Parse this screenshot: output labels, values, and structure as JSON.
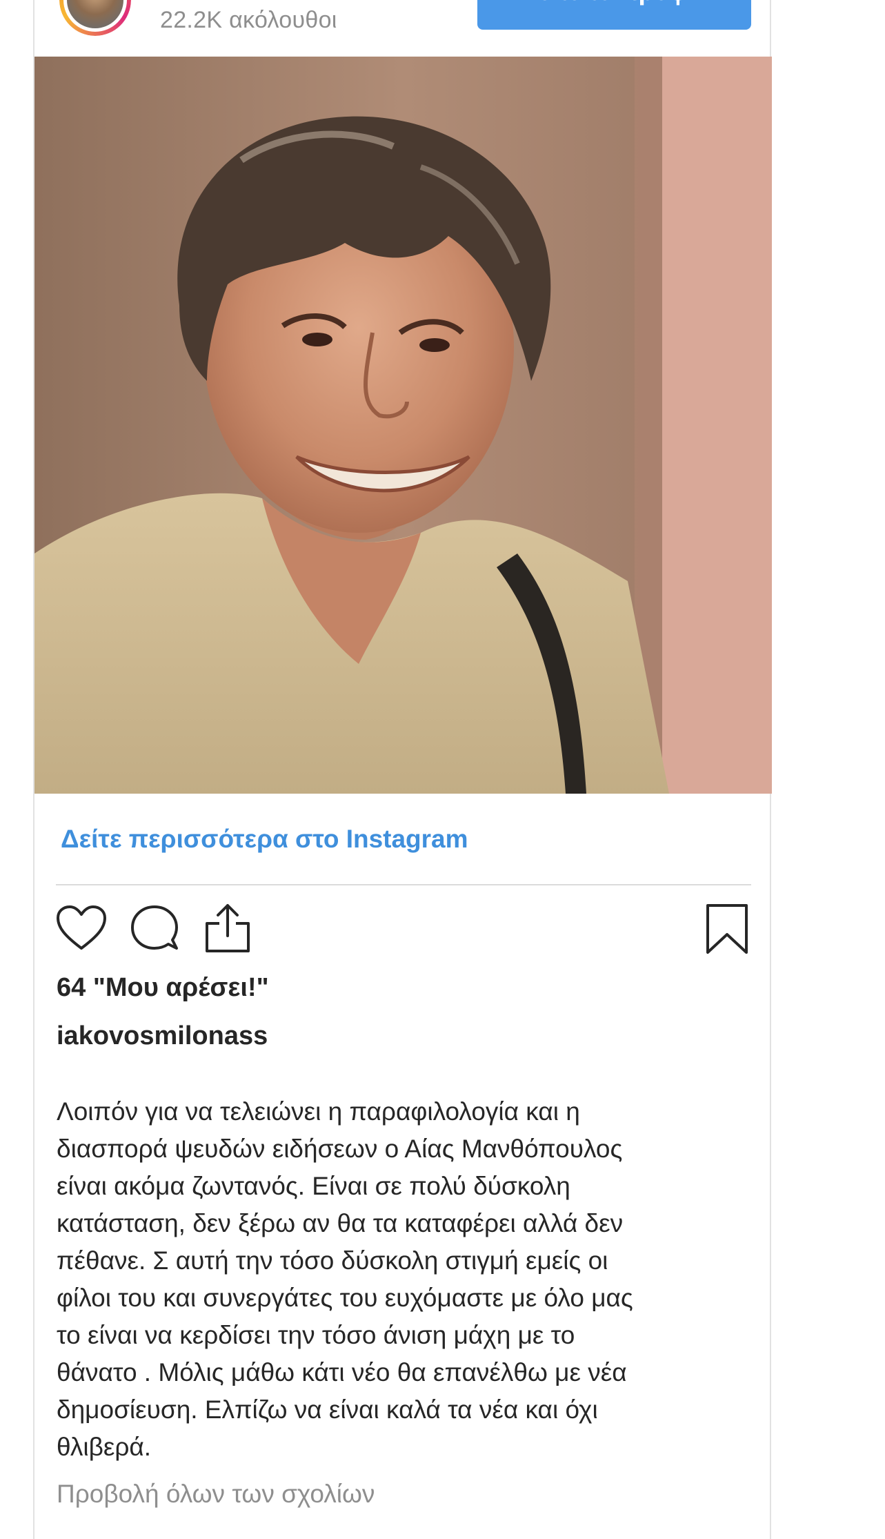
{
  "header": {
    "followers": "22.2K ακόλουθοι",
    "view_profile_label": "Δείτε το προφίλ"
  },
  "post": {
    "image_alt": "Smiling man with grey-streaked hair in a beige shirt",
    "see_more_label": "Δείτε περισσότερα στο Instagram",
    "likes": "64 \"Μου αρέσει!\"",
    "username": "iakovosmilonass",
    "caption": "Λοιπόν για να τελειώνει η παραφιλολογία και η\nδιασπορά ψευδών ειδήσεων ο Αίας Μανθόπουλος\nείναι ακόμα ζωντανός. Είναι σε πολύ δύσκολη\nκατάσταση, δεν ξέρω αν θα τα καταφέρει αλλά δεν\nπέθανε. Σ αυτή την τόσο δύσκολη στιγμή εμείς οι\nφίλοι του και συνεργάτες του ευχόμαστε με όλο μας\nτο είναι να κερδίσει την τόσο άνιση μάχη με το\nθάνατο . Μόλις μάθω κάτι νέο θα επανέλθω με νέα\nδημοσίευση. Ελπίζω να είναι καλά τα νέα και όχι\nθλιβερά.",
    "view_comments_label": "Προβολή όλων των σχολίων"
  },
  "icons": {
    "like": "heart-icon",
    "comment": "comment-icon",
    "share": "share-icon",
    "save": "bookmark-icon"
  },
  "colors": {
    "accent_blue": "#4a98e8",
    "link_blue": "#3f8fdc",
    "text": "#262626",
    "muted": "#8e8e8e"
  }
}
